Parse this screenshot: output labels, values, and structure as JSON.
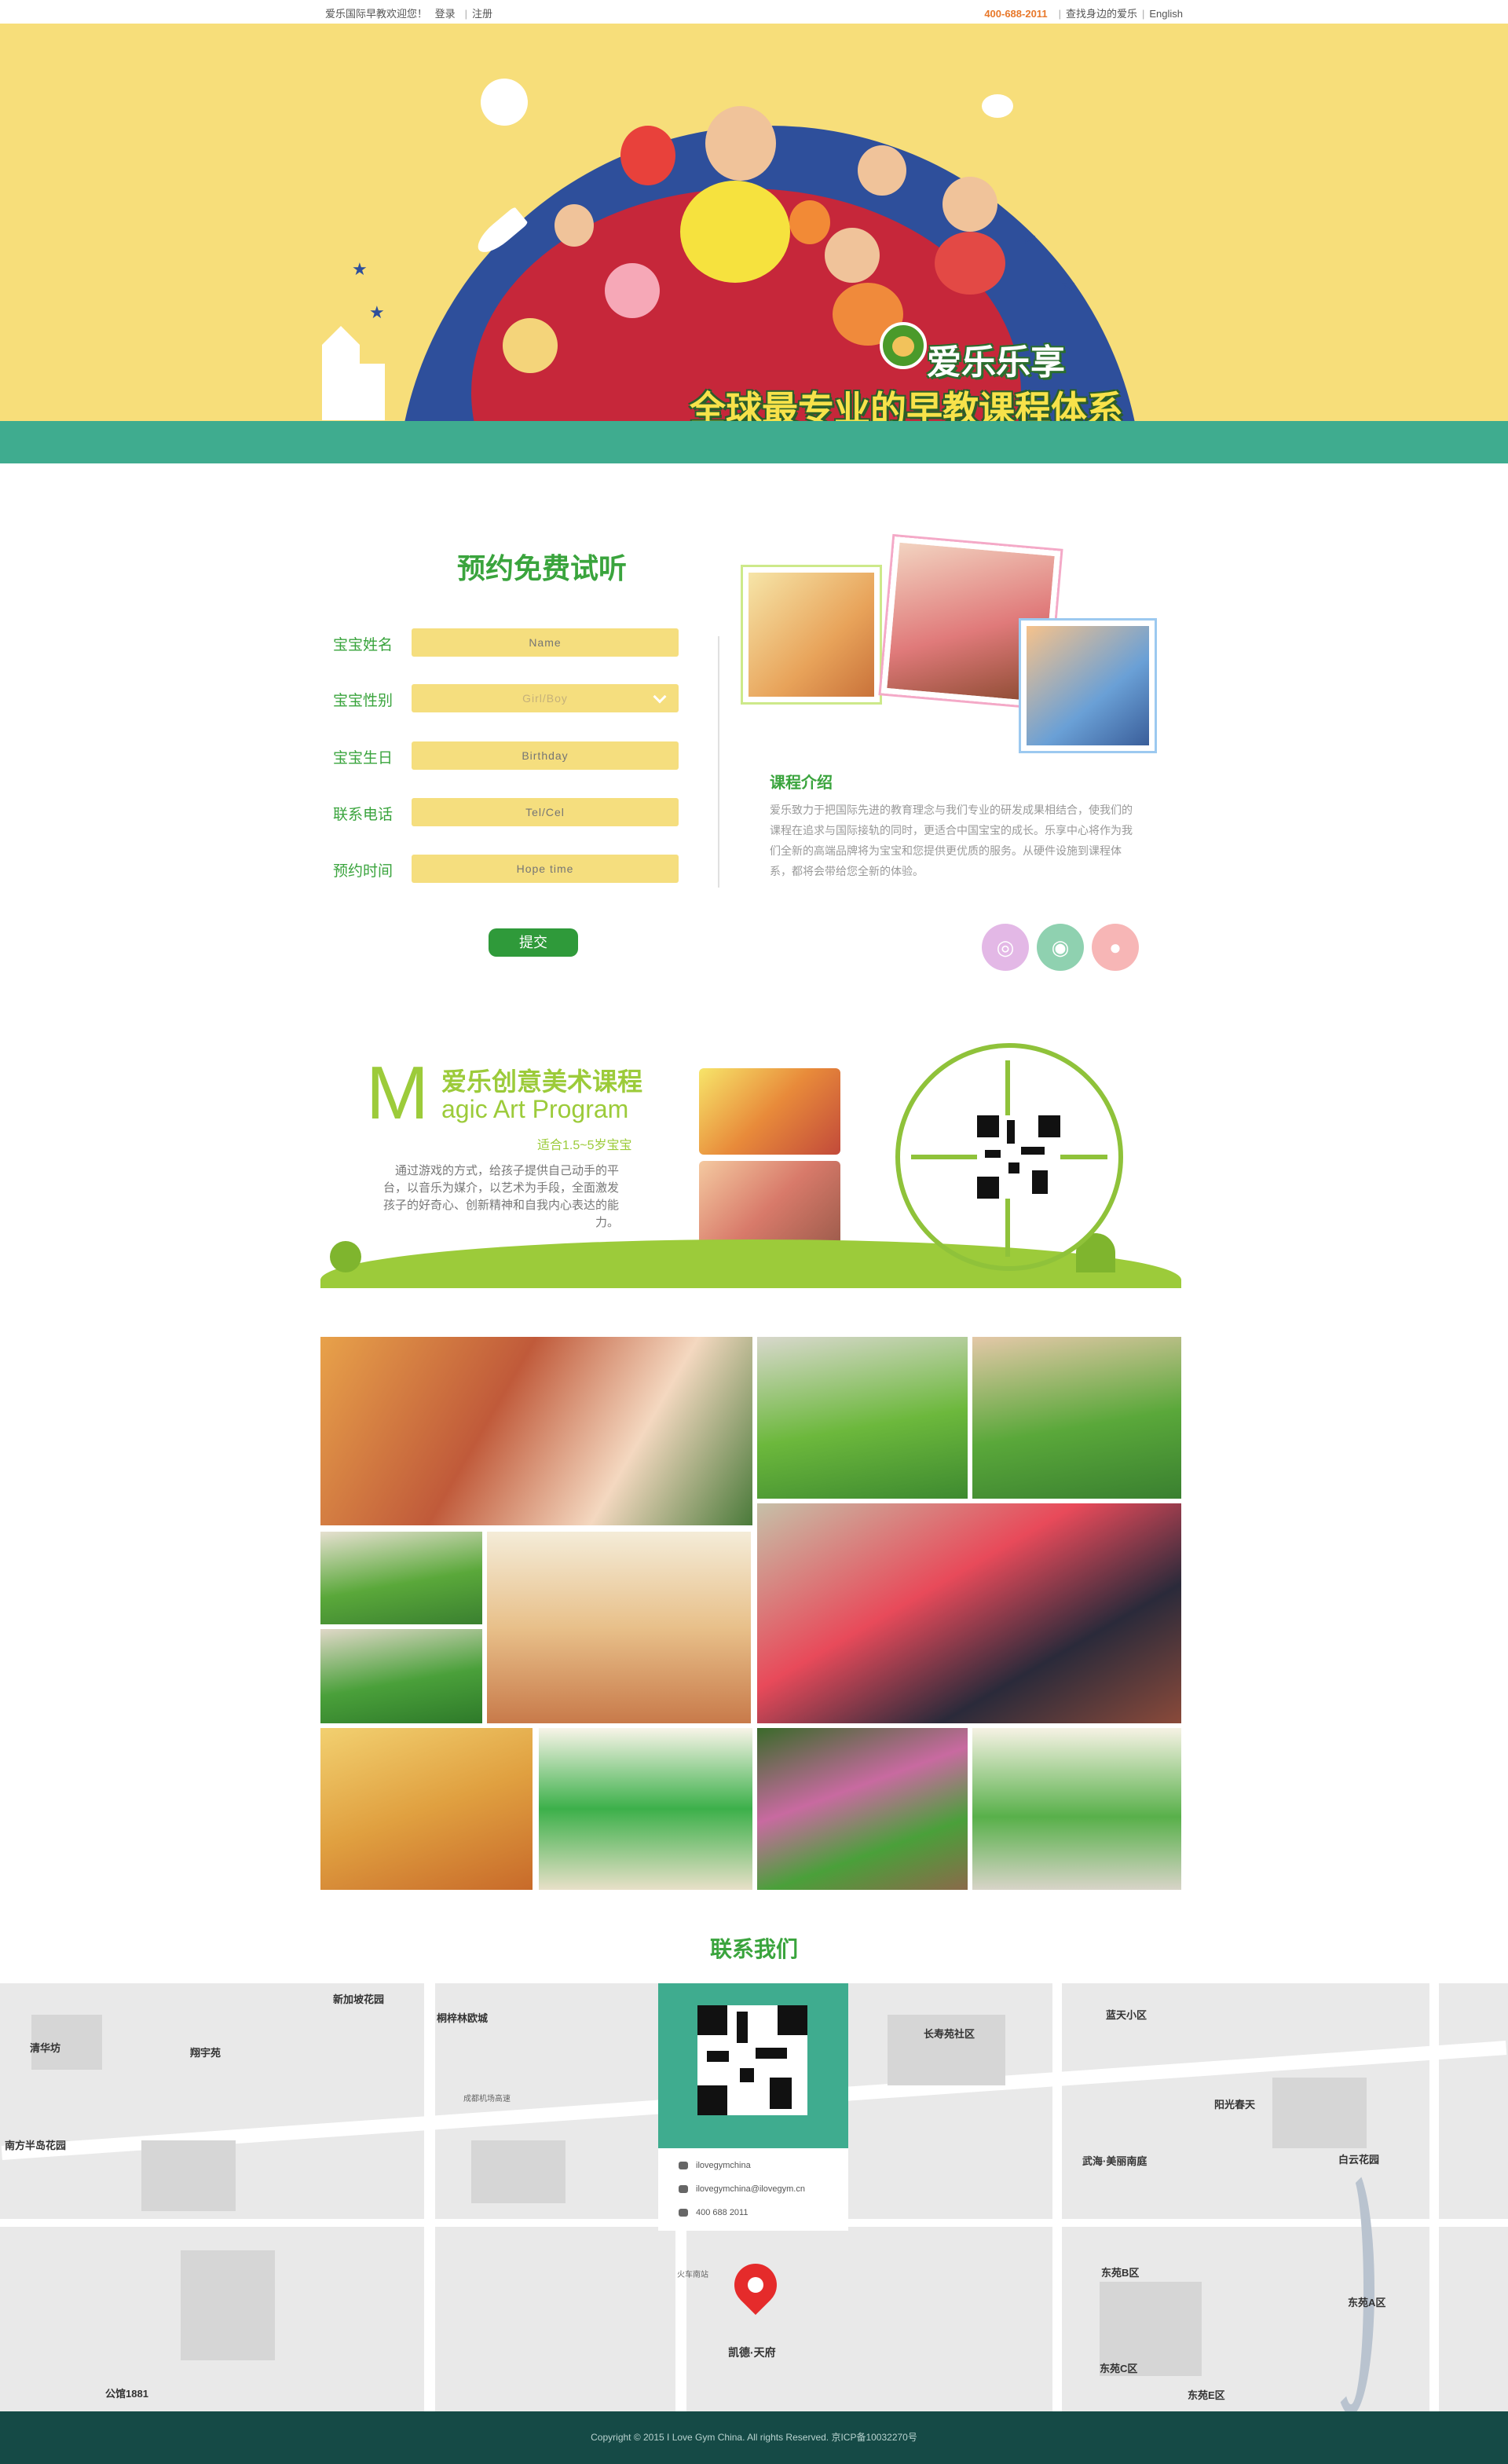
{
  "topbar": {
    "welcome": "爱乐国际早教欢迎您！",
    "login": "登录",
    "register": "注册",
    "phone": "400-688-2011",
    "find_store": "查找身边的爱乐",
    "language": "English"
  },
  "hero": {
    "brand": "爱乐乐享",
    "slogan": "全球最专业的早教课程体系",
    "colors": {
      "background": "#f7de7a",
      "band": "#3fac8f",
      "dome": "#2e4f9b"
    }
  },
  "booking": {
    "title": "预约免费试听",
    "fields": [
      {
        "label": "宝宝姓名",
        "placeholder": "Name"
      },
      {
        "label": "宝宝性别",
        "placeholder": "Girl/Boy"
      },
      {
        "label": "宝宝生日",
        "placeholder": "Birthday"
      },
      {
        "label": "联系电话",
        "placeholder": "Tel/Cel"
      },
      {
        "label": "预约时间",
        "placeholder": "Hope time"
      }
    ],
    "submit_label": "提交"
  },
  "course": {
    "title": "课程介绍",
    "text": "爱乐致力于把国际先进的教育理念与我们专业的研发成果相结合，使我们的课程在追求与国际接轨的同时，更适合中国宝宝的成长。乐享中心将作为我们全新的高端品牌将为宝宝和您提供更优质的服务。从硬件设施到课程体系，都将会带给您全新的体验。"
  },
  "social": [
    {
      "icon": "swirl-icon",
      "color": "#e3b8e6"
    },
    {
      "icon": "weibo-icon",
      "color": "#8fd1b0"
    },
    {
      "icon": "wechat-icon",
      "color": "#f7b6b6"
    }
  ],
  "art": {
    "big_letter": "M",
    "title_cn": "爱乐创意美术课程",
    "title_en": "agic Art Program",
    "age": "适合1.5~5岁宝宝",
    "description": "通过游戏的方式，给孩子提供自己动手的平台，以音乐为媒介，以艺术为手段，全面激发孩子的好奇心、创新精神和自我内心表达的能力。"
  },
  "contact": {
    "title": "联系我们",
    "wechat": "ilovegymchina",
    "email": "ilovegymchina@ilovegym.cn",
    "phone": "400 688 2011",
    "location_label": "凯德·天府",
    "map_labels": [
      "清华坊",
      "翔宇苑",
      "南方半岛花园",
      "新加坡花园",
      "桐梓林欧城",
      "公馆1881",
      "长寿苑社区",
      "蓝天小区",
      "阳光春天",
      "白云花园",
      "武海·美丽南庭",
      "东苑B区",
      "东苑A区",
      "东苑C区",
      "东苑E区",
      "成都机场高速",
      "火车南站"
    ]
  },
  "footer": {
    "copyright": "Copyright © 2015 I Love Gym China. All rights Reserved. 京ICP备10032270号"
  }
}
